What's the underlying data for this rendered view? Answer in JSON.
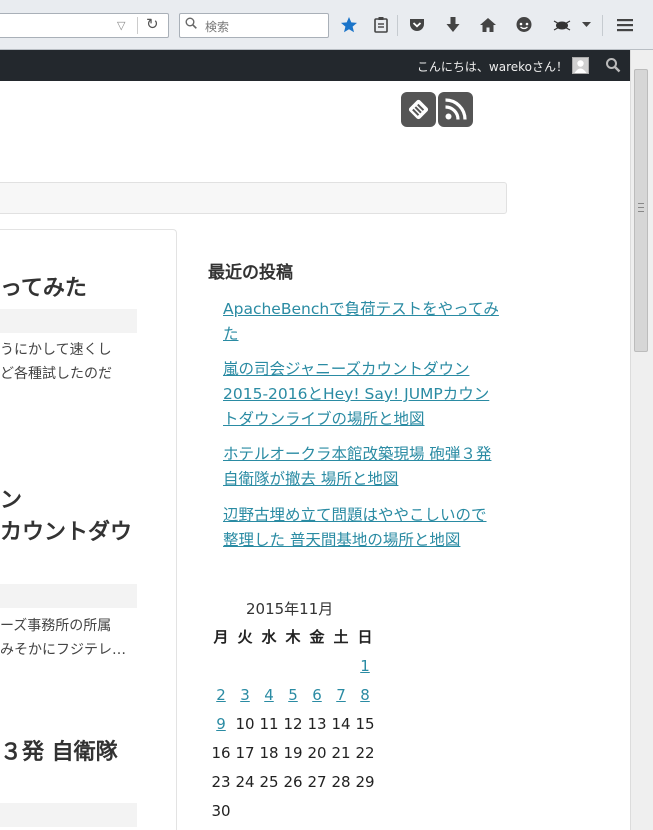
{
  "browser": {
    "search_placeholder": "検索",
    "accent": "#1b74c9"
  },
  "adminbar": {
    "greeting": "こんにちは、warekoさん！"
  },
  "posts": [
    {
      "title_lines": [
        "ってみた"
      ],
      "excerpt_lines": [
        "うにかして速くし",
        "ど各種試したのだ"
      ]
    },
    {
      "title_lines": [
        "ン",
        "カウントダウ"
      ],
      "excerpt_lines": [
        "ーズ事務所の所属",
        "みそかにフジテレ…"
      ]
    },
    {
      "title_lines": [
        "３発 自衛隊"
      ],
      "excerpt_lines": []
    }
  ],
  "sidebar": {
    "recent_title": "最近の投稿",
    "recent_posts": [
      {
        "lines": [
          "ApacheBenchで負荷テストをやってみ",
          "た"
        ]
      },
      {
        "lines": [
          "嵐の司会ジャニーズカウントダウン",
          "2015-2016とHey! Say! JUMPカウン",
          "トダウンライブの場所と地図"
        ]
      },
      {
        "lines": [
          "ホテルオークラ本館改築現場 砲弾３発",
          "自衛隊が撤去 場所と地図"
        ]
      },
      {
        "lines": [
          "辺野古埋め立て問題はややこしいので",
          "整理した 普天間基地の場所と地図"
        ]
      }
    ],
    "calendar": {
      "caption": "2015年11月",
      "weekdays": [
        "月",
        "火",
        "水",
        "木",
        "金",
        "土",
        "日"
      ],
      "rows": [
        [
          "",
          "",
          "",
          "",
          "",
          "",
          "1"
        ],
        [
          "2",
          "3",
          "4",
          "5",
          "6",
          "7",
          "8"
        ],
        [
          "9",
          "10",
          "11",
          "12",
          "13",
          "14",
          "15"
        ],
        [
          "16",
          "17",
          "18",
          "19",
          "20",
          "21",
          "22"
        ],
        [
          "23",
          "24",
          "25",
          "26",
          "27",
          "28",
          "29"
        ],
        [
          "30",
          "",
          "",
          "",
          "",
          "",
          ""
        ]
      ],
      "linked_days": [
        "1",
        "2",
        "3",
        "4",
        "5",
        "6",
        "7",
        "8",
        "9"
      ]
    }
  }
}
